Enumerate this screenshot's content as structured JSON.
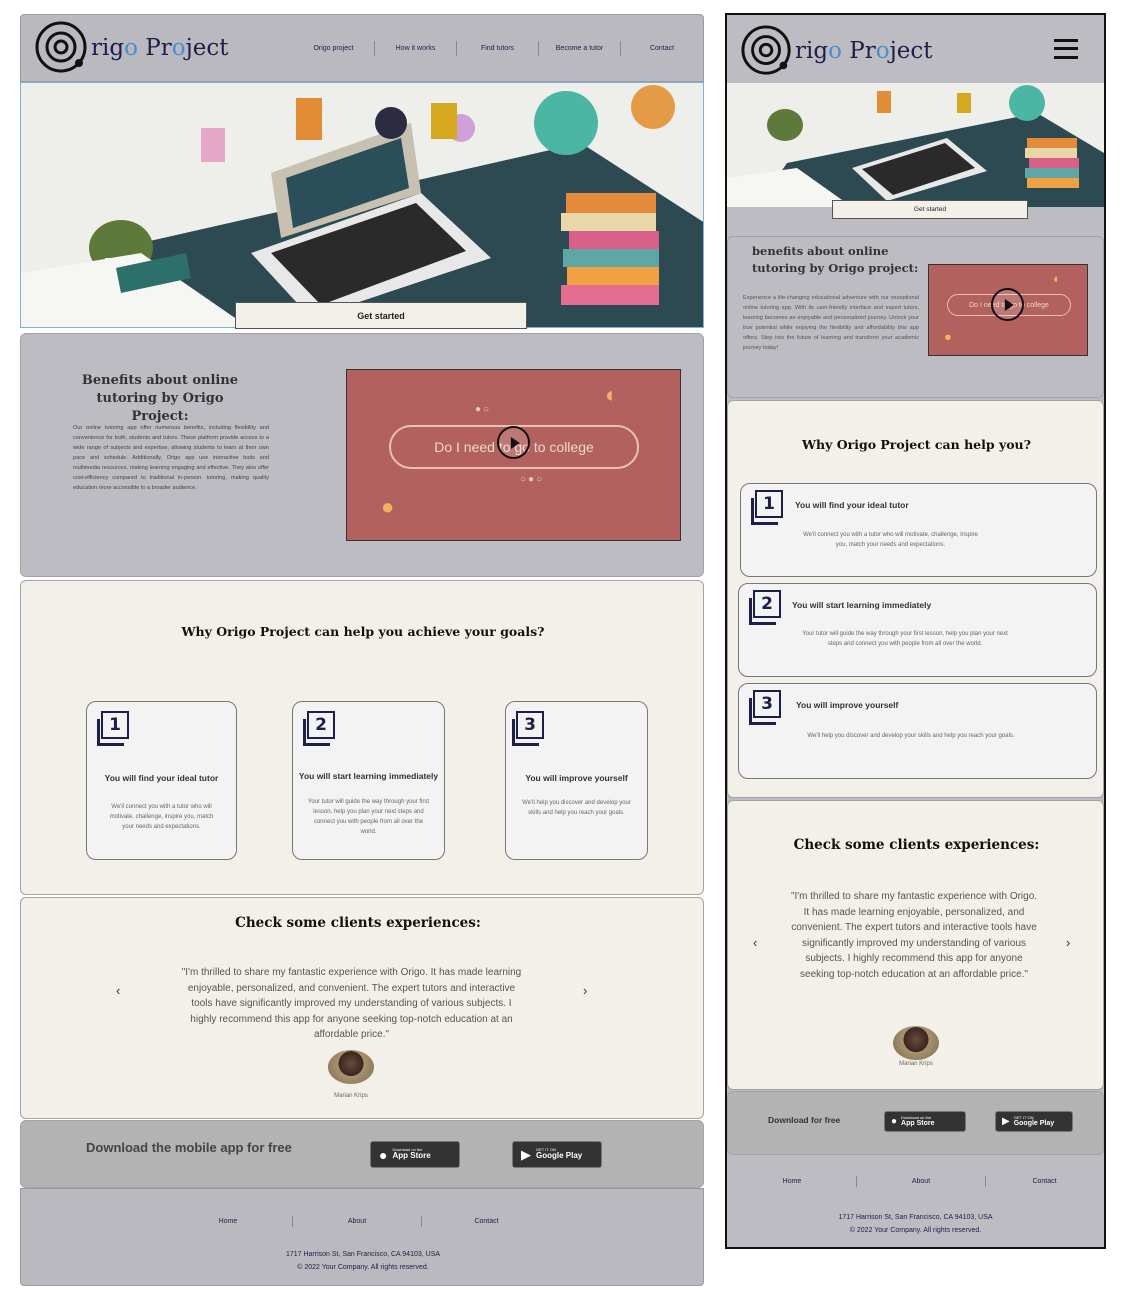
{
  "brand": {
    "logo_text_a": "rig",
    "logo_text_b": "o",
    "logo_text_c": " Pr",
    "logo_text_d": "o",
    "logo_text_e": "ject"
  },
  "nav": {
    "items": [
      "Origo project",
      "How it works",
      "Find tutors",
      "Become a tutor",
      "Contact"
    ]
  },
  "hero": {
    "cta_label": "Get started"
  },
  "benefits": {
    "title": "Benefits about online tutoring by Origo Project:",
    "title_mobile": "benefits about online tutoring by Origo project:",
    "body": "Our online tutoring app offer numerous benefits, including flexibility and convenience for both, students and tutors. These platform provide access to a wide range of subjects and expertise, allowing students to learn at their own pace and schedule. Additionally, Origo app use interactive tools and multimedia resources, making learning engaging and effective. They also offer cost-efficiency compared to traditional in-person. tutoring, making quality education more accessible to a broader audience.",
    "body_mobile": "Experience a life-changing educational adventure with our exceptional online tutoring app. With its user-friendly interface and expert tutors, learning becomes an enjoyable and personalized journey. Unlock your true potential while enjoying the flexibility and affordability this app offers. Step into the future of learning and transform your academic journey today!",
    "video_text": "Do I need to go to college",
    "video_text_mobile": "Do I need to go to college"
  },
  "why": {
    "title": "Why Origo Project can help you achieve your goals?",
    "title_mobile": "Why Origo Project can help you?",
    "cards": [
      {
        "num": "1",
        "title": "You will find your ideal tutor",
        "text": "We'll connect you with a tutor who will motivate, challenge, inspire you, match your needs and expectations.",
        "text_mobile": "We'll connect you with a tutor who will motivate, challenge, inspire you, match your needs and expectations."
      },
      {
        "num": "2",
        "title": "You will start learning immediately",
        "text": "Your tutor will guide the way through your first lesson, help you plan your next steps and connect you with people from all over the world.",
        "text_mobile": "Your tutor will guide the way through your first lesson, help you plan your next steps and connect you with people from all over the world."
      },
      {
        "num": "3",
        "title": "You will improve yourself",
        "text": "We'll help you discover and develop your skills and help you reach your goals.",
        "text_mobile": "We'll help you discover and develop your skills and help you reach your goals."
      }
    ]
  },
  "clients": {
    "title": "Check some clients experiences:",
    "quote": "\"I'm thrilled to share my fantastic experience with Origo. It has made learning enjoyable, personalized, and convenient. The expert tutors and interactive tools have significantly improved my understanding of various subjects. I highly recommend this app for anyone seeking top-notch education at an affordable price.\"",
    "name": "Marian Krips",
    "prev": "‹",
    "next": "›"
  },
  "download": {
    "title": "Download the mobile app for free",
    "title_mobile": "Download for free",
    "appstore_small": "Download on the",
    "appstore_big": "App Store",
    "gplay_small": "GET IT ON",
    "gplay_big": "Google Play"
  },
  "footer": {
    "links": [
      "Home",
      "About",
      "Contact"
    ],
    "address": "1717 Harrison St, San Francisco, CA 94103, USA",
    "copyright": "© 2022 Your Company.  All rights reserved."
  },
  "colors": {
    "navy": "#1d1f4a",
    "accent": "#4c8fcf",
    "video": "#b2615f",
    "grey": "#bcbcc2",
    "cream": "#f2f0e8"
  }
}
